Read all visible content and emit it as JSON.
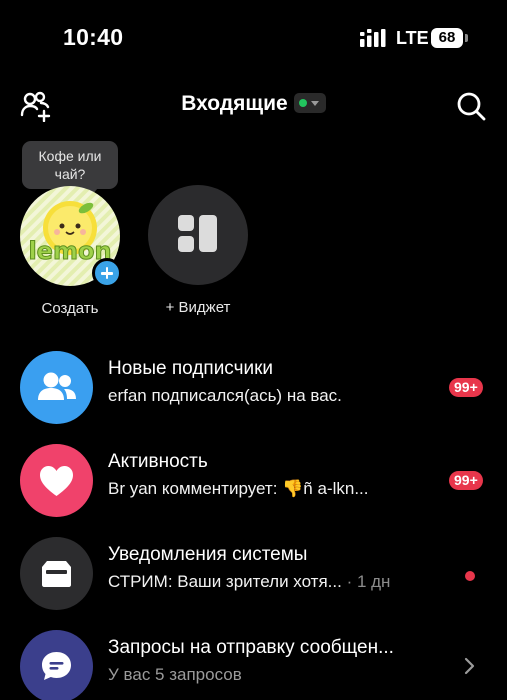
{
  "status_bar": {
    "time": "10:40",
    "network": "LTE",
    "battery": "68"
  },
  "header": {
    "title": "Входящие",
    "status_color": "#22c55e",
    "icons": [
      "add-friends-icon",
      "search-icon"
    ]
  },
  "stories": {
    "tooltip": "Кофе или чай?",
    "create_label": "Создать",
    "avatar_text": "lemon",
    "widget_label": "+ Виджет"
  },
  "inbox": [
    {
      "icon": "followers-icon",
      "icon_color": "#3a9ff0",
      "title": "Новые подписчики",
      "subtitle": "erfan подписался(ась) на вас.",
      "badge": "99+"
    },
    {
      "icon": "heart-icon",
      "icon_color": "#f0426b",
      "title": "Активность",
      "subtitle": "Br yan комментирует: 👎ñ a-lkn...",
      "badge": "99+"
    },
    {
      "icon": "inbox-tray-icon",
      "icon_color": "#2c2c2e",
      "title": "Уведомления системы",
      "subtitle": "СТРИМ: Ваши зрители хотя...",
      "time": " · 1 дн",
      "unread": true
    },
    {
      "icon": "message-request-icon",
      "icon_color": "#3b3f8c",
      "title": "Запросы на отправку сообщен...",
      "subtitle": "У вас 5 запросов"
    }
  ]
}
